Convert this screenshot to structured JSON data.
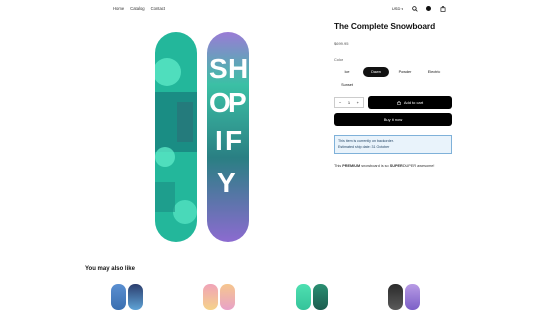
{
  "nav": {
    "home": "Home",
    "catalog": "Catalog",
    "contact": "Contact"
  },
  "header": {
    "currency": "USD",
    "currency_caret": "▾",
    "search_icon": "search-icon",
    "account_icon": "avatar",
    "cart_icon": "cart-icon"
  },
  "product": {
    "title": "The Complete Snowboard",
    "price": "$699.95",
    "color_label": "Color",
    "colors": [
      "Ice",
      "Dawn",
      "Powder",
      "Electric",
      "Sunset"
    ],
    "selected_color": "Dawn",
    "quantity": "1",
    "add_to_cart": "Add to cart",
    "buy_now": "Buy it now",
    "notice_line1": "This item is currently on backorder.",
    "notice_line2": "Estimated ship date: 31 October",
    "description_pre": "This ",
    "description_b1": "PREMIUM",
    "description_mid": " snowboard is so ",
    "description_b2": "SUPER",
    "description_post": "DUPER awesome!",
    "board_lettering": "SHOPIFY"
  },
  "related": {
    "heading": "You may also like"
  },
  "colors": {
    "accent": "#000000",
    "notice_bg": "#e9f3fb",
    "notice_border": "#7fb1d9",
    "board_teal": "#2fcfb0",
    "board_purple": "#9a7bd6"
  }
}
